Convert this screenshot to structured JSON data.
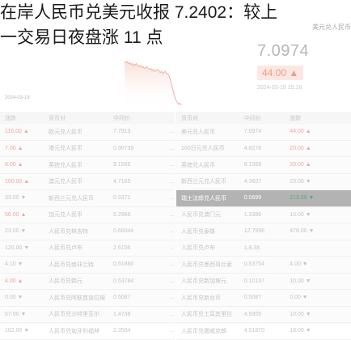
{
  "headline": {
    "line1": "在岸人民币兑美元收报 7.2402：较上",
    "line2": "一交易日夜盘涨 11 点"
  },
  "top_right_label": "美元兑人民币",
  "quote": {
    "price": "7.0974",
    "change": "44.00 ▲",
    "time": "2024-03-19 15:16"
  },
  "chart": {
    "time_label": "2024-03-19",
    "points": [
      3,
      4,
      3,
      5,
      4,
      6,
      5,
      7,
      6,
      5,
      7,
      8,
      7,
      9,
      8,
      10,
      9,
      8,
      10,
      11,
      10,
      12,
      11,
      13,
      12,
      11,
      12,
      14,
      13,
      15,
      14,
      13,
      15,
      16,
      18,
      22,
      28,
      33,
      38,
      42,
      44,
      46,
      45,
      47
    ]
  },
  "left_table": {
    "headers": [
      "涨跌",
      "货币对",
      "中间价",
      ""
    ],
    "rows": [
      {
        "rate": "116.00 ▲",
        "name": "欧元兑人民币",
        "mid": "7.7913",
        "tag": "..."
      },
      {
        "rate": "7.00 ▲",
        "name": "港元兑人民币",
        "mid": "0.90739",
        "tag": "..."
      },
      {
        "rate": "8.00 ▲",
        "name": "英镑兑人民币",
        "mid": "9.1565",
        "tag": "..."
      },
      {
        "rate": "100.00 ▲",
        "name": "澳元兑人民币",
        "mid": "4.7165",
        "tag": "..."
      },
      {
        "rate": "33.00 ▼",
        "name": "新西兰元兑人民币",
        "mid": "0.3371",
        "tag": "..."
      },
      {
        "rate": "56.00 ▲",
        "name": "加元兑人民币",
        "mid": "5.2966",
        "tag": "..."
      },
      {
        "rate": "23.00 ▼",
        "name": "人民币兑林吉特",
        "mid": "0.66044",
        "tag": "..."
      },
      {
        "rate": "120.00 ▼",
        "name": "人民币兑卢布",
        "mid": "2.6156",
        "tag": "..."
      },
      {
        "rate": "4.10 ▼",
        "name": "人民币兑南非兰特",
        "mid": "0.51860",
        "tag": "..."
      },
      {
        "rate": "4.00 ▲",
        "name": "人民币兑韩元",
        "mid": "0.53784",
        "tag": "..."
      },
      {
        "rate": "0.00 ▼",
        "name": "人民币兑阿联酋迪拉姆",
        "mid": "0.5087",
        "tag": "..."
      },
      {
        "rate": "57.00 ▼",
        "name": "人民币兑沙特里亚尔",
        "mid": "1.4739",
        "tag": "..."
      },
      {
        "rate": "102.00 ▼",
        "name": "人民币兑匈牙利福林",
        "mid": "2.3504",
        "tag": "..."
      }
    ]
  },
  "right_table": {
    "headers": [
      "货币对",
      "中间价",
      "涨跌",
      ""
    ],
    "rows": [
      {
        "name": "美元兑人民币",
        "mid": "7.0974",
        "rate": "44.00 ▲",
        "tag": ""
      },
      {
        "name": "100日元兑人民币",
        "mid": "4.8276",
        "rate": "20.00 ▲",
        "tag": ""
      },
      {
        "name": "英镑兑人民币",
        "mid": "9.1569",
        "rate": "20.00 ▲",
        "tag": ""
      },
      {
        "name": "新西兰元兑人民币",
        "mid": "4.3607",
        "rate": "23.00 ▼",
        "tag": ""
      },
      {
        "name": "瑞士法郎兑人民币",
        "mid": "0.0699",
        "rate": "213.00 ▼",
        "tag": ""
      },
      {
        "name": "人民币兑澳门元",
        "mid": "1.3396",
        "rate": "10.00 ▼",
        "tag": ""
      },
      {
        "name": "人民币兑泰铢",
        "mid": "12.7996",
        "rate": "476.00 ▼",
        "tag": ""
      },
      {
        "name": "人民币兑卢布",
        "mid": "1.8.38",
        "rate": "",
        "tag": ""
      },
      {
        "name": "人民币兑墨西哥比索",
        "mid": "0.53754",
        "rate": "4.00 ▼",
        "tag": ""
      },
      {
        "name": "人民币兑新加坡元",
        "mid": "0.10137",
        "rate": "10.00 ▼",
        "tag": ""
      },
      {
        "name": "人民币兑新台币",
        "mid": "0.5087",
        "rate": "0.00 ▼",
        "tag": ""
      },
      {
        "name": "人民币兑土耳其里拉",
        "mid": "4.5855",
        "rate": "10.00 ▼",
        "tag": ""
      },
      {
        "name": "人民币兑挪威克朗",
        "mid": "4.01870",
        "rate": "18.00 ▼",
        "tag": ""
      }
    ],
    "highlight_row": 4
  }
}
